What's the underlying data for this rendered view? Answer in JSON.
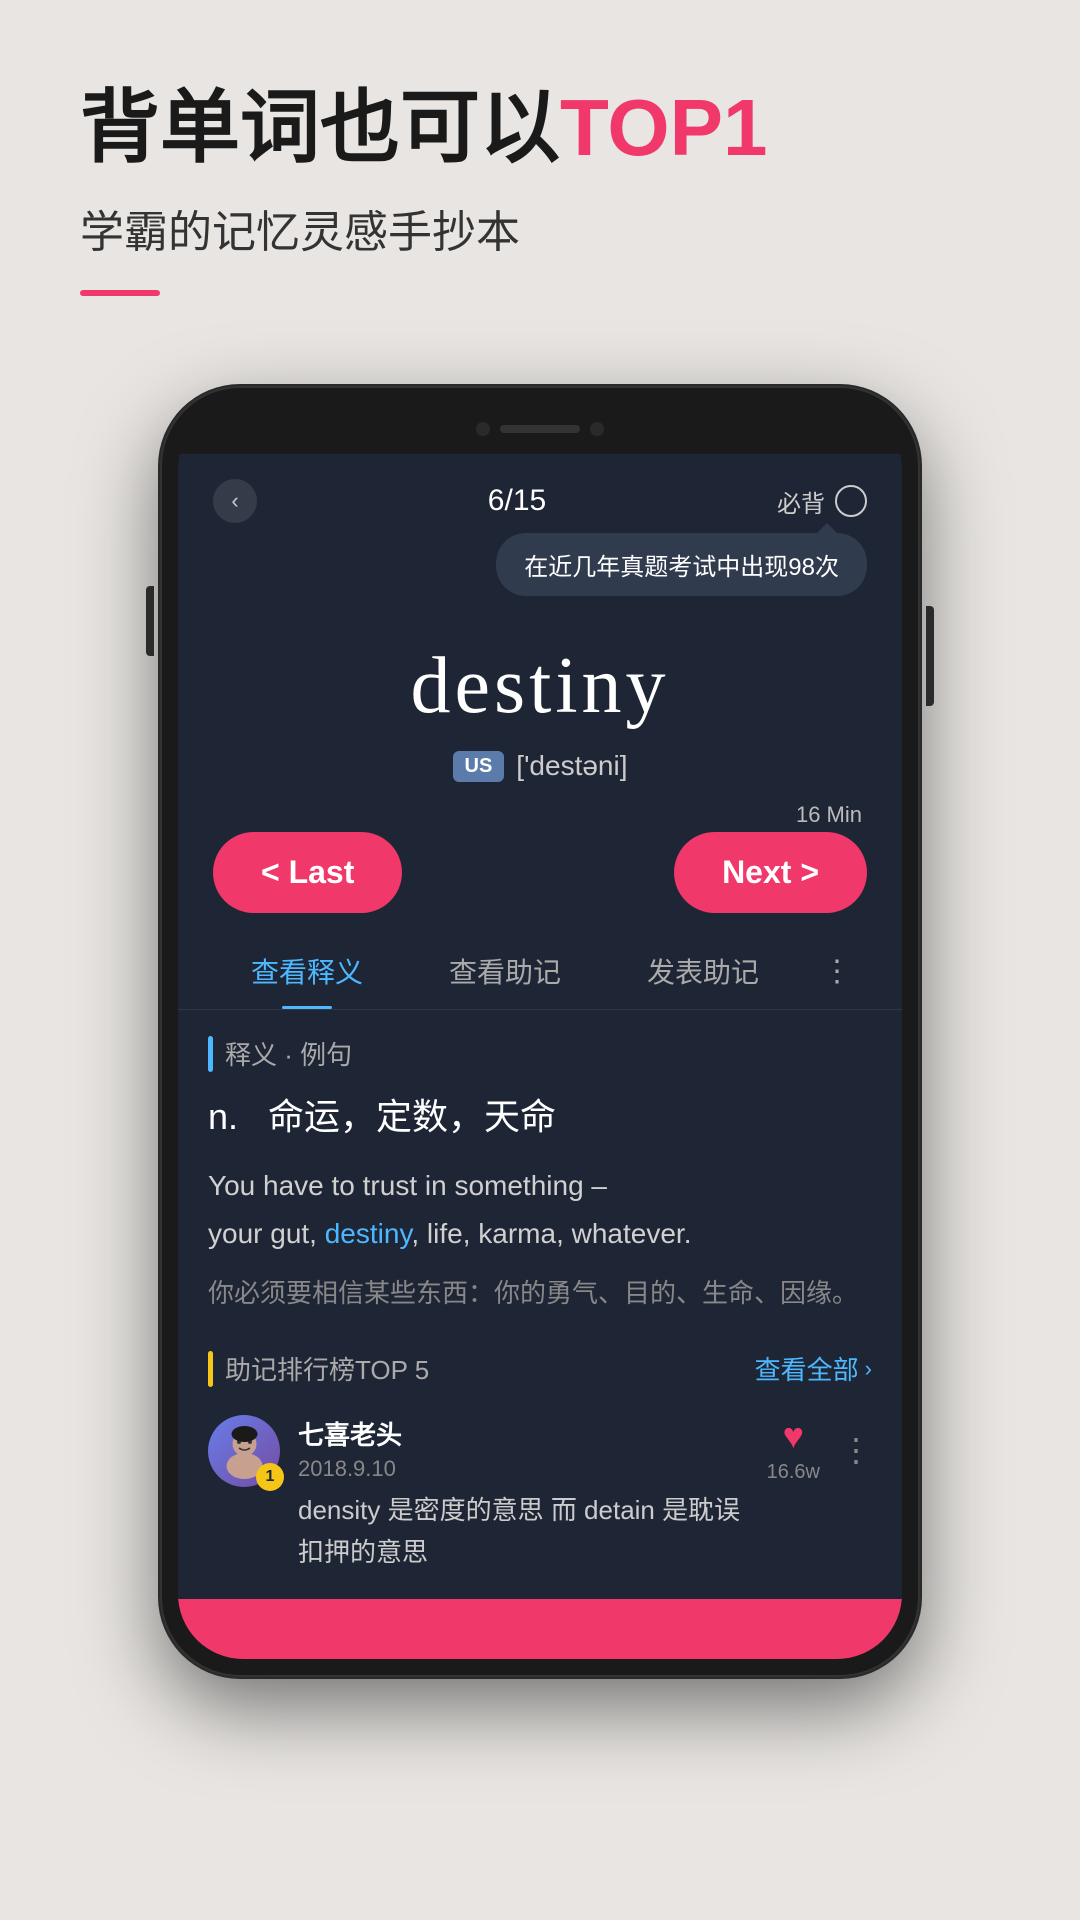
{
  "header": {
    "title_start": "背单词也可以",
    "title_highlight": "TOP1",
    "subtitle": "学霸的记忆灵感手抄本"
  },
  "phone": {
    "progress": "6/15",
    "must_remember": "必背",
    "tooltip": "在近几年真题考试中出现98次",
    "word": "destiny",
    "us_label": "US",
    "phonetic": "['destəni]",
    "time_label": "16 Min",
    "btn_last": "< Last",
    "btn_next": "Next >",
    "tabs": [
      {
        "label": "查看释义",
        "active": true
      },
      {
        "label": "查看助记",
        "active": false
      },
      {
        "label": "发表助记",
        "active": false
      }
    ],
    "section_def_label": "释义 · 例句",
    "definition": {
      "pos": "n.",
      "cn": "命运，定数，天命",
      "example_en_parts": [
        "You have to trust in something –",
        "your gut, ",
        "destiny",
        ", life, karma, whatever."
      ],
      "example_cn": "你必须要相信某些东西：你的勇气、目的、生命、因缘。"
    },
    "mnemonic_title": "助记排行榜TOP 5",
    "view_all": "查看全部",
    "user_entry": {
      "name": "七喜老头",
      "date": "2018.9.10",
      "rank": "1",
      "like_count": "16.6w",
      "content": "density 是密度的意思 而 detain 是耽误扣押的意思"
    }
  }
}
